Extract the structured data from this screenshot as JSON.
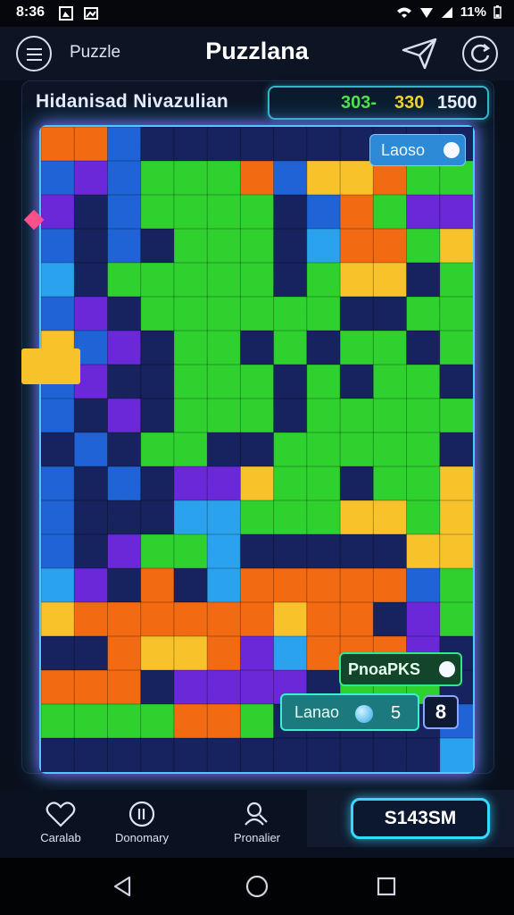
{
  "status_bar": {
    "time": "8:36",
    "battery": "11%"
  },
  "app_bar": {
    "label": "Puzzle",
    "title": "Puzzlana"
  },
  "board_header": {
    "title": "Hidanisad Nivazulian",
    "score_a": "303-",
    "score_b": "330",
    "score_c": "1500"
  },
  "board": {
    "top_pill_label": "Laoso",
    "mid_pill_label": "PnoaPKS",
    "bottom_pill_label": "Lanao",
    "bottom_pill_value": "5",
    "count_value": "8"
  },
  "bottom_nav": {
    "items": [
      {
        "label": "Caralab",
        "icon": "heart-icon"
      },
      {
        "label": "Donomary",
        "icon": "coin-icon"
      },
      {
        "label": "Pronalier",
        "icon": "search-person-icon"
      }
    ],
    "play_label": "S143SM"
  },
  "colors": {
    "green": "#2fd12f",
    "blue": "#1f63d6",
    "purple": "#6a28d8",
    "orange": "#f26a12",
    "yellow": "#f7c22a",
    "navy": "#16235e",
    "cyan": "#2aa2ee",
    "accent": "#36d8ff"
  }
}
